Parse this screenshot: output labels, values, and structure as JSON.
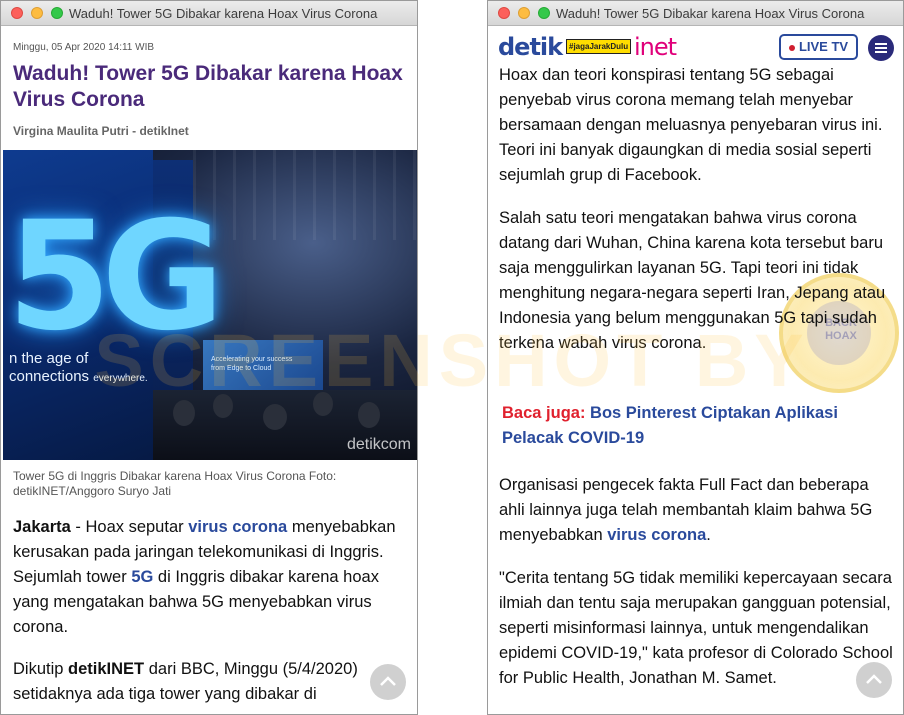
{
  "left_window": {
    "title": "Waduh! Tower 5G Dibakar karena Hoax Virus Corona",
    "date": "Minggu, 05 Apr 2020 14:11 WIB",
    "headline": "Waduh! Tower 5G Dibakar karena Hoax Virus Corona",
    "author": "Virgina Maulita Putri - detikInet",
    "photo": {
      "big_text": "5G",
      "slogan_line1": "n the age of",
      "slogan_line2": "connections",
      "slogan_everywhere": "everywhere.",
      "screen_line1": "Accelerating your success",
      "screen_line2": "from Edge to Cloud",
      "watermark": "detikcom"
    },
    "caption": "Tower 5G di Inggris Dibakar karena Hoax Virus Corona Foto: detikINET/Anggoro Suryo Jati",
    "p1": {
      "lead": "Jakarta",
      "t1": " - Hoax seputar ",
      "link1": "virus corona",
      "t2": " menyebabkan kerusakan pada jaringan telekomunikasi di Inggris. Sejumlah tower ",
      "link2": "5G",
      "t3": " di Inggris dibakar karena hoax yang mengatakan bahwa 5G menyebabkan virus corona."
    },
    "p2": {
      "t1": "Dikutip ",
      "strong": "detikINET",
      "t2": " dari BBC, Minggu (5/4/2020) setidaknya ada tiga tower yang dibakar di"
    }
  },
  "right_window": {
    "title": "Waduh! Tower 5G Dibakar karena Hoax Virus Corona",
    "logo_detik": "detik",
    "logo_tag": "#jagaJarakDulu",
    "logo_inet": "inet",
    "live_tv": "LIVE TV",
    "p1": "Hoax dan teori konspirasi tentang 5G sebagai penyebab virus corona memang telah menyebar bersamaan dengan meluasnya penyebaran virus ini. Teori ini banyak digaungkan di media sosial seperti sejumlah grup di Facebook.",
    "p2": "Salah satu teori mengatakan bahwa virus corona datang dari Wuhan, China karena kota tersebut baru saja menggulirkan layanan 5G. Tapi teori ini tidak menghitung negara-negara seperti Iran, Jepang atau Indonesia yang belum menggunakan 5G tapi sudah terkena wabah virus corona.",
    "baca_label": "Baca juga:",
    "baca_link": " Bos Pinterest Ciptakan Aplikasi Pelacak COVID-19",
    "p3": {
      "t1": "Organisasi pengecek fakta Full Fact dan beberapa ahli lainnya juga telah membantah klaim bahwa 5G menyebabkan ",
      "link": "virus corona",
      "t2": "."
    },
    "p4": "\"Cerita tentang 5G tidak memiliki kepercayaan secara ilmiah dan tentu saja merupakan gangguan potensial, seperti misinformasi lainnya, untuk mengendalikan epidemi COVID-19,\" kata profesor di Colorado School for Public Health, Jonathan M. Samet.",
    "seal_text": "BACK HOAX"
  },
  "overlay_watermark": "SCREENSHOT BY",
  "colors": {
    "headline": "#4a2a7a",
    "link": "#2a4a9c",
    "baca_label": "#e0212e",
    "inet": "#e0007a",
    "live_dot": "#d01f2f"
  }
}
